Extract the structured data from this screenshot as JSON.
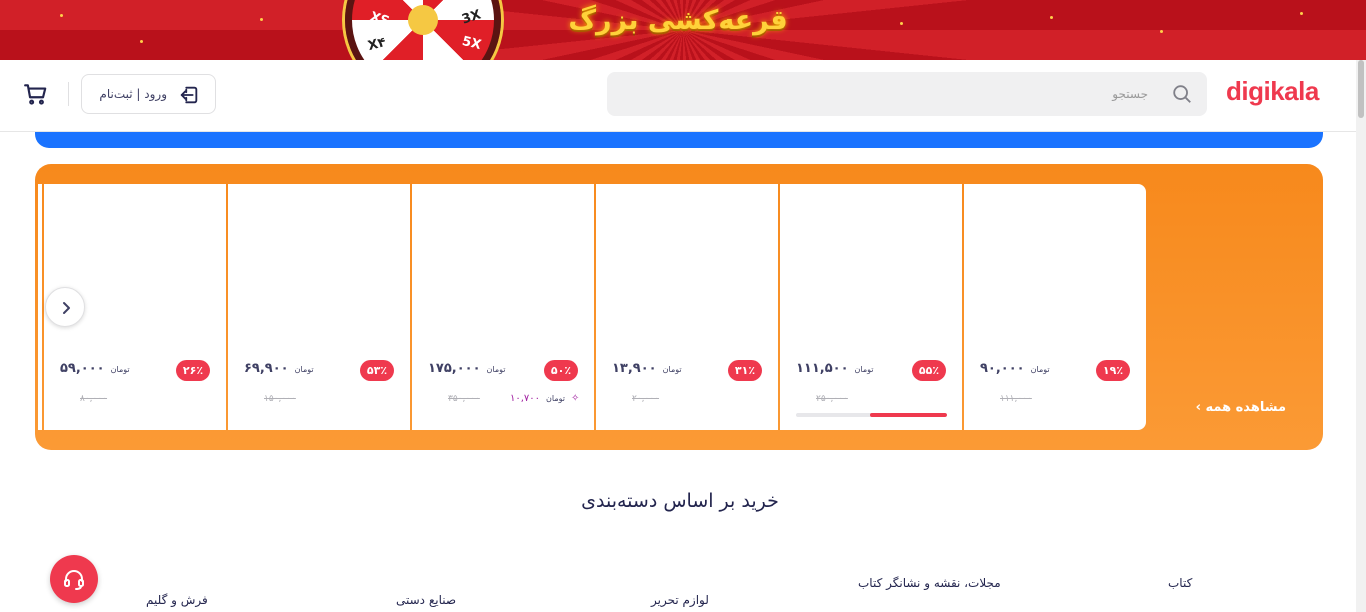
{
  "banner": {
    "title": "قرعه‌کشی بزرگ",
    "wheel_labels": [
      "XS",
      "3X",
      "5X",
      "X۴"
    ]
  },
  "header": {
    "logo": "digikala",
    "search": {
      "placeholder": "جستجو",
      "value": ""
    },
    "login_label": "ورود | ثبت‌نام",
    "icons": {
      "search": "search-icon",
      "login": "login-icon",
      "cart": "cart-icon"
    }
  },
  "amazing": {
    "see_all": "مشاهده همه ›",
    "nav_icon": "chevron-right-icon",
    "products": [
      {
        "discount": "۱۹٪",
        "price": "۹۰,۰۰۰",
        "currency": "تومان",
        "old_price": "۱۱۱,۰۰۰"
      },
      {
        "discount": "۵۵٪",
        "price": "۱۱۱,۵۰۰",
        "currency": "تومان",
        "old_price": "۲۵۰,۰۰۰",
        "sold_fraction": 0.51
      },
      {
        "discount": "۳۱٪",
        "price": "۱۳,۹۰۰",
        "currency": "تومان",
        "old_price": "۲۰,۰۰۰"
      },
      {
        "discount": "۵۰٪",
        "price": "۱۷۵,۰۰۰",
        "currency": "تومان",
        "old_price": "۳۵۰,۰۰۰",
        "bonus": "۱۰,۷۰۰",
        "bonus_currency": "تومان"
      },
      {
        "discount": "۵۳٪",
        "price": "۶۹,۹۰۰",
        "currency": "تومان",
        "old_price": "۱۵۰,۰۰۰"
      },
      {
        "discount": "۲۶٪",
        "price": "۵۹,۰۰۰",
        "currency": "تومان",
        "old_price": "۸۰,۰۰۰"
      }
    ]
  },
  "categories": {
    "title": "خرید بر اساس دسته‌بندی",
    "items": [
      "کتاب",
      "مجلات، نقشه و نشانگر کتاب",
      "لوازم تحریر",
      "صنایع دستی",
      "فرش و گلیم"
    ]
  },
  "support_icon": "headset-icon",
  "colors": {
    "brand": "#ef394e",
    "amazing_bg": "#f7891c",
    "blue_bar": "#1a73ff"
  }
}
